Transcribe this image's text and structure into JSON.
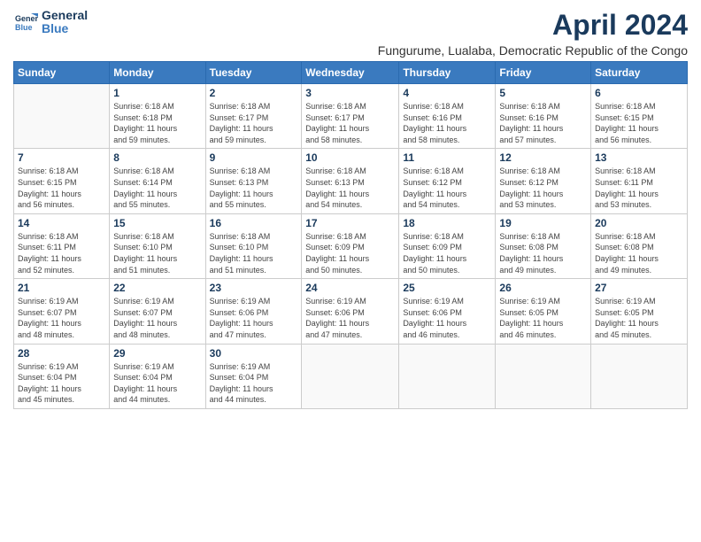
{
  "logo": {
    "line1": "General",
    "line2": "Blue"
  },
  "title": "April 2024",
  "subtitle": "Fungurume, Lualaba, Democratic Republic of the Congo",
  "days_of_week": [
    "Sunday",
    "Monday",
    "Tuesday",
    "Wednesday",
    "Thursday",
    "Friday",
    "Saturday"
  ],
  "weeks": [
    [
      {
        "num": "",
        "info": ""
      },
      {
        "num": "1",
        "info": "Sunrise: 6:18 AM\nSunset: 6:18 PM\nDaylight: 11 hours\nand 59 minutes."
      },
      {
        "num": "2",
        "info": "Sunrise: 6:18 AM\nSunset: 6:17 PM\nDaylight: 11 hours\nand 59 minutes."
      },
      {
        "num": "3",
        "info": "Sunrise: 6:18 AM\nSunset: 6:17 PM\nDaylight: 11 hours\nand 58 minutes."
      },
      {
        "num": "4",
        "info": "Sunrise: 6:18 AM\nSunset: 6:16 PM\nDaylight: 11 hours\nand 58 minutes."
      },
      {
        "num": "5",
        "info": "Sunrise: 6:18 AM\nSunset: 6:16 PM\nDaylight: 11 hours\nand 57 minutes."
      },
      {
        "num": "6",
        "info": "Sunrise: 6:18 AM\nSunset: 6:15 PM\nDaylight: 11 hours\nand 56 minutes."
      }
    ],
    [
      {
        "num": "7",
        "info": "Sunrise: 6:18 AM\nSunset: 6:15 PM\nDaylight: 11 hours\nand 56 minutes."
      },
      {
        "num": "8",
        "info": "Sunrise: 6:18 AM\nSunset: 6:14 PM\nDaylight: 11 hours\nand 55 minutes."
      },
      {
        "num": "9",
        "info": "Sunrise: 6:18 AM\nSunset: 6:13 PM\nDaylight: 11 hours\nand 55 minutes."
      },
      {
        "num": "10",
        "info": "Sunrise: 6:18 AM\nSunset: 6:13 PM\nDaylight: 11 hours\nand 54 minutes."
      },
      {
        "num": "11",
        "info": "Sunrise: 6:18 AM\nSunset: 6:12 PM\nDaylight: 11 hours\nand 54 minutes."
      },
      {
        "num": "12",
        "info": "Sunrise: 6:18 AM\nSunset: 6:12 PM\nDaylight: 11 hours\nand 53 minutes."
      },
      {
        "num": "13",
        "info": "Sunrise: 6:18 AM\nSunset: 6:11 PM\nDaylight: 11 hours\nand 53 minutes."
      }
    ],
    [
      {
        "num": "14",
        "info": "Sunrise: 6:18 AM\nSunset: 6:11 PM\nDaylight: 11 hours\nand 52 minutes."
      },
      {
        "num": "15",
        "info": "Sunrise: 6:18 AM\nSunset: 6:10 PM\nDaylight: 11 hours\nand 51 minutes."
      },
      {
        "num": "16",
        "info": "Sunrise: 6:18 AM\nSunset: 6:10 PM\nDaylight: 11 hours\nand 51 minutes."
      },
      {
        "num": "17",
        "info": "Sunrise: 6:18 AM\nSunset: 6:09 PM\nDaylight: 11 hours\nand 50 minutes."
      },
      {
        "num": "18",
        "info": "Sunrise: 6:18 AM\nSunset: 6:09 PM\nDaylight: 11 hours\nand 50 minutes."
      },
      {
        "num": "19",
        "info": "Sunrise: 6:18 AM\nSunset: 6:08 PM\nDaylight: 11 hours\nand 49 minutes."
      },
      {
        "num": "20",
        "info": "Sunrise: 6:18 AM\nSunset: 6:08 PM\nDaylight: 11 hours\nand 49 minutes."
      }
    ],
    [
      {
        "num": "21",
        "info": "Sunrise: 6:19 AM\nSunset: 6:07 PM\nDaylight: 11 hours\nand 48 minutes."
      },
      {
        "num": "22",
        "info": "Sunrise: 6:19 AM\nSunset: 6:07 PM\nDaylight: 11 hours\nand 48 minutes."
      },
      {
        "num": "23",
        "info": "Sunrise: 6:19 AM\nSunset: 6:06 PM\nDaylight: 11 hours\nand 47 minutes."
      },
      {
        "num": "24",
        "info": "Sunrise: 6:19 AM\nSunset: 6:06 PM\nDaylight: 11 hours\nand 47 minutes."
      },
      {
        "num": "25",
        "info": "Sunrise: 6:19 AM\nSunset: 6:06 PM\nDaylight: 11 hours\nand 46 minutes."
      },
      {
        "num": "26",
        "info": "Sunrise: 6:19 AM\nSunset: 6:05 PM\nDaylight: 11 hours\nand 46 minutes."
      },
      {
        "num": "27",
        "info": "Sunrise: 6:19 AM\nSunset: 6:05 PM\nDaylight: 11 hours\nand 45 minutes."
      }
    ],
    [
      {
        "num": "28",
        "info": "Sunrise: 6:19 AM\nSunset: 6:04 PM\nDaylight: 11 hours\nand 45 minutes."
      },
      {
        "num": "29",
        "info": "Sunrise: 6:19 AM\nSunset: 6:04 PM\nDaylight: 11 hours\nand 44 minutes."
      },
      {
        "num": "30",
        "info": "Sunrise: 6:19 AM\nSunset: 6:04 PM\nDaylight: 11 hours\nand 44 minutes."
      },
      {
        "num": "",
        "info": ""
      },
      {
        "num": "",
        "info": ""
      },
      {
        "num": "",
        "info": ""
      },
      {
        "num": "",
        "info": ""
      }
    ]
  ]
}
